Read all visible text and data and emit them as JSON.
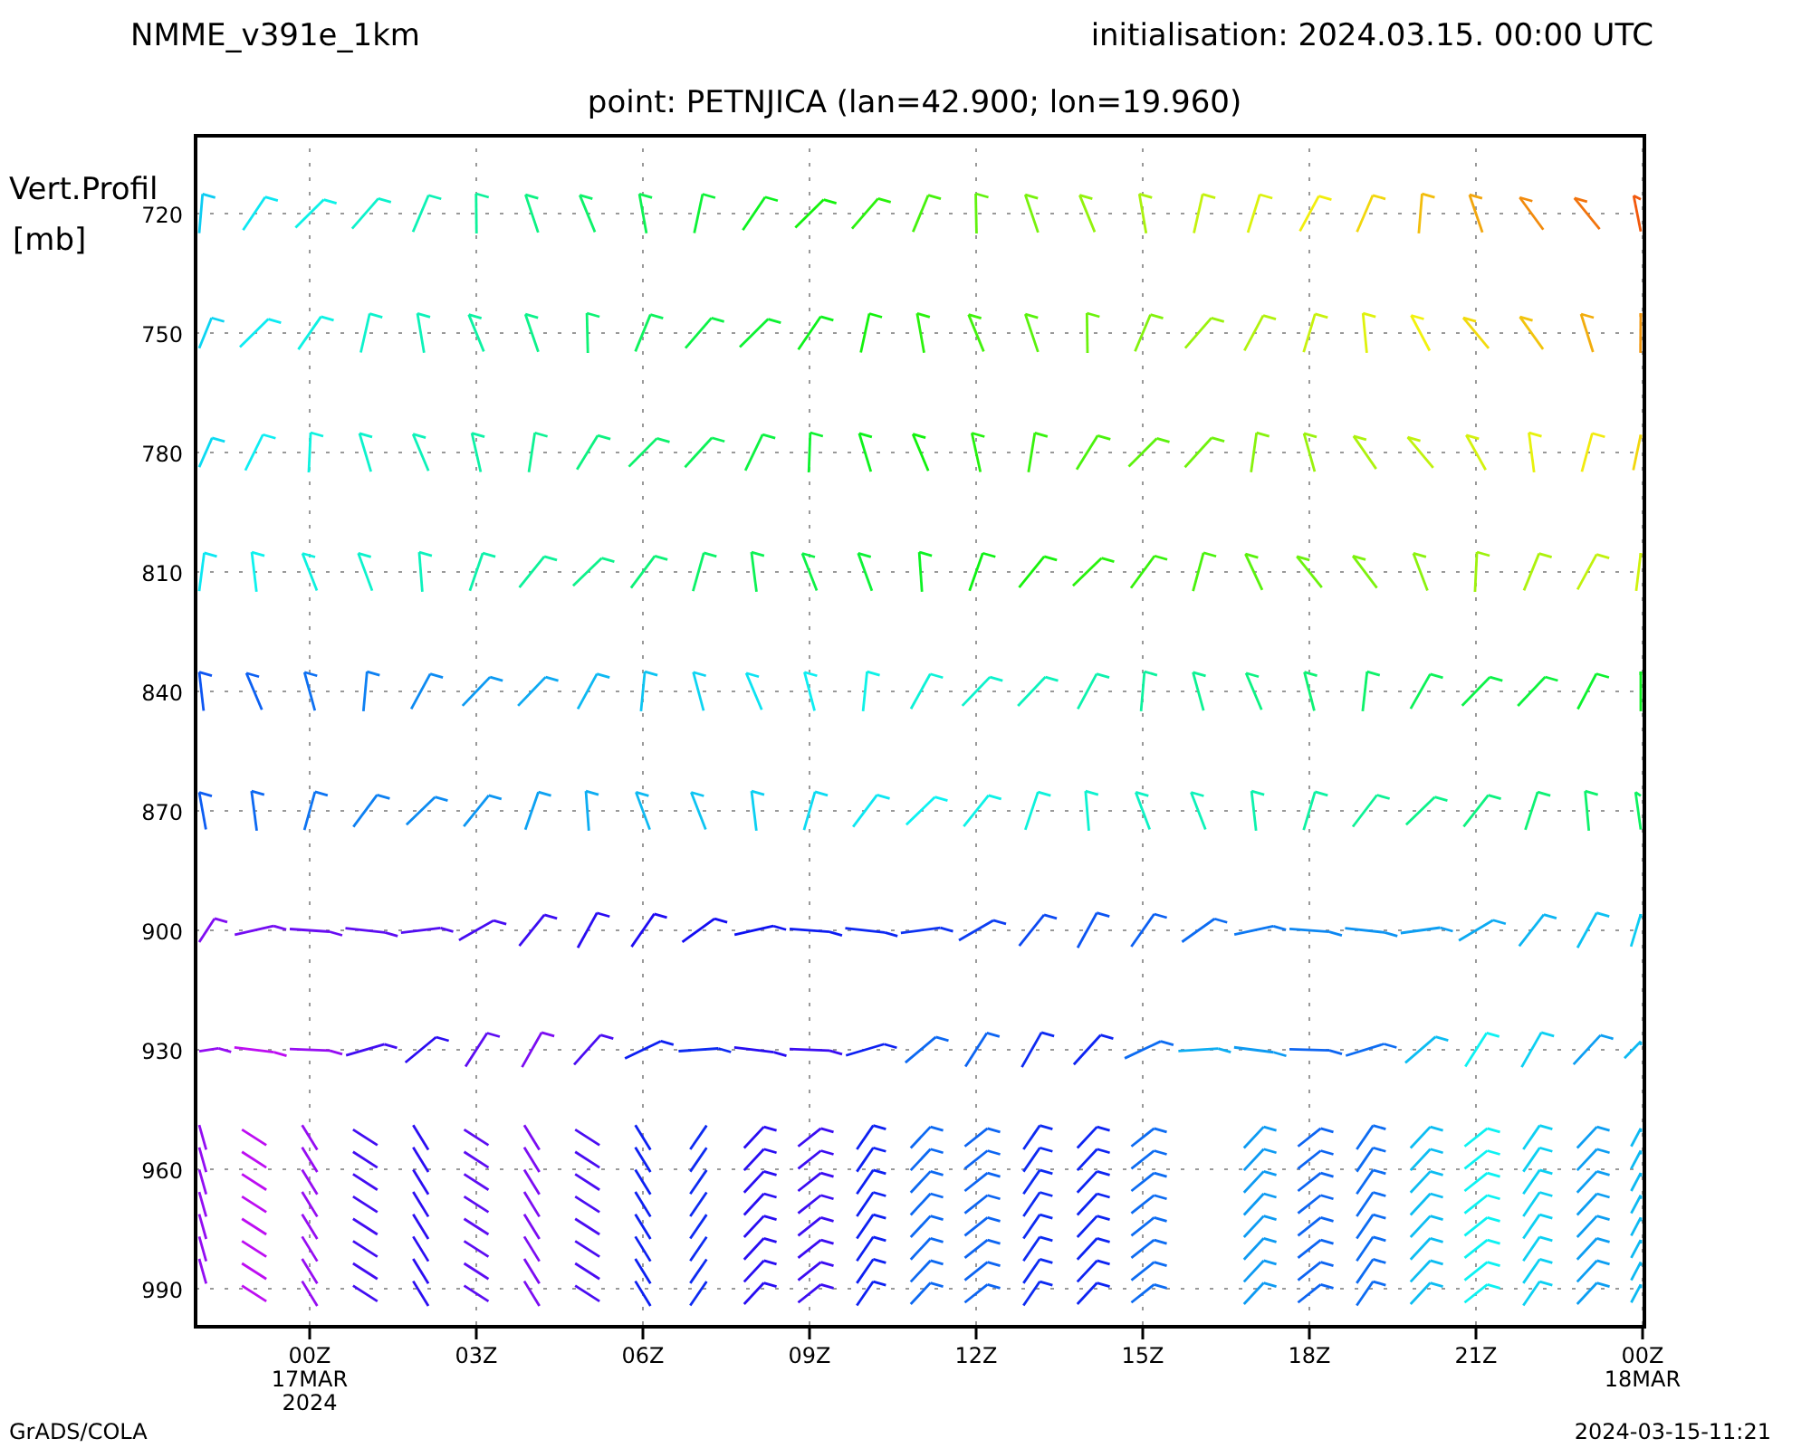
{
  "header": {
    "model": "NMME_v391e_1km",
    "initialisation": "initialisation: 2024.03.15. 00:00 UTC"
  },
  "plot": {
    "title": "point: PETNJICA (lan=42.900; lon=19.960)",
    "y_axis": {
      "title": "Vert.Profil",
      "unit": "[mb]",
      "ticks": [
        "720",
        "750",
        "780",
        "810",
        "840",
        "870",
        "900",
        "930",
        "960",
        "990"
      ]
    },
    "x_axis": {
      "ticks": [
        {
          "lines": [
            "00Z",
            "17MAR",
            "2024"
          ]
        },
        {
          "lines": [
            "03Z"
          ]
        },
        {
          "lines": [
            "06Z"
          ]
        },
        {
          "lines": [
            "09Z"
          ]
        },
        {
          "lines": [
            "12Z"
          ]
        },
        {
          "lines": [
            "15Z"
          ]
        },
        {
          "lines": [
            "18Z"
          ]
        },
        {
          "lines": [
            "21Z"
          ]
        },
        {
          "lines": [
            "00Z",
            "18MAR"
          ]
        }
      ]
    }
  },
  "footer": {
    "credit": "GrADS/COLA",
    "timestamp": "2024-03-15-11:21"
  }
}
